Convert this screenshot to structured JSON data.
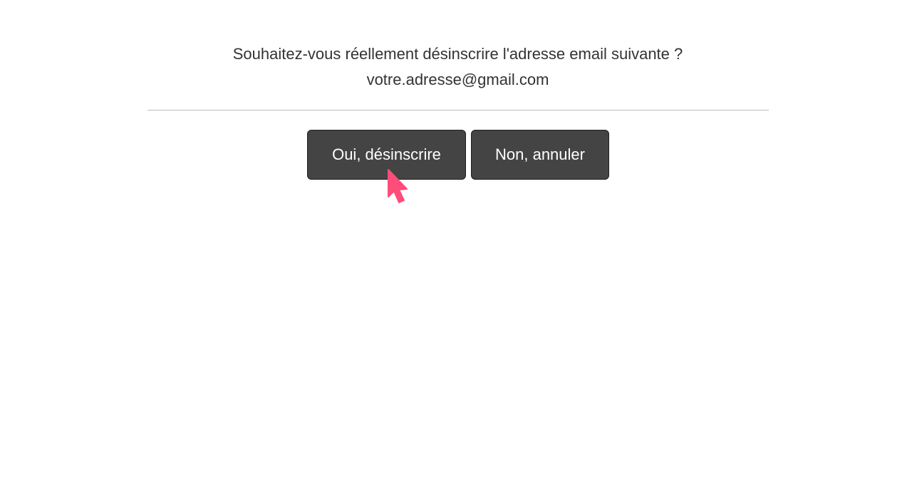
{
  "dialog": {
    "question": "Souhaitez-vous réellement désinscrire l'adresse email suivante ?",
    "email": "votre.adresse@gmail.com"
  },
  "actions": {
    "confirm_label": "Oui, désinscrire",
    "cancel_label": "Non, annuler"
  },
  "colors": {
    "button_background": "#444444",
    "button_text": "#ffffff",
    "cursor": "#ff4d7a",
    "text": "#333333",
    "divider": "#bdbdbd"
  },
  "icons": {
    "cursor": "mouse-pointer-icon"
  }
}
